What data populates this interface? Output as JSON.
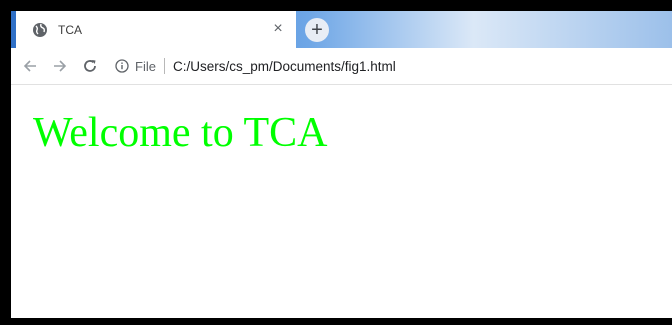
{
  "browser": {
    "tab": {
      "title": "TCA",
      "close_glyph": "×",
      "icon": "globe-icon"
    },
    "new_tab_glyph": "+",
    "toolbar": {
      "back_icon": "arrow-left-icon",
      "forward_icon": "arrow-right-icon",
      "reload_icon": "reload-icon",
      "site_info_icon": "info-icon",
      "site_label": "File",
      "url": "C:/Users/cs_pm/Documents/fig1.html"
    }
  },
  "page": {
    "heading": "Welcome to TCA",
    "heading_color": "#00ff00"
  }
}
